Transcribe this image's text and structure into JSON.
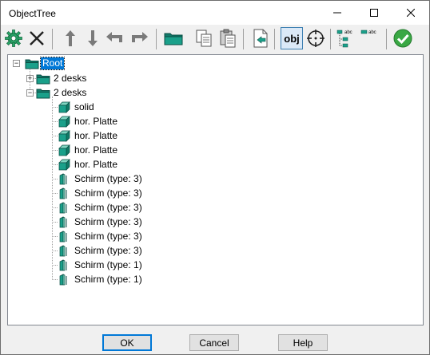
{
  "window": {
    "title": "ObjectTree"
  },
  "toolbar": {
    "buttons": [
      {
        "name": "settings-gear-icon"
      },
      {
        "name": "delete-x-icon"
      },
      {
        "name": "move-up-icon"
      },
      {
        "name": "move-down-icon"
      },
      {
        "name": "move-left-icon"
      },
      {
        "name": "move-right-icon"
      },
      {
        "name": "folder-icon"
      },
      {
        "name": "copy-icon"
      },
      {
        "name": "paste-icon"
      },
      {
        "name": "export-icon"
      },
      {
        "name": "obj-toggle",
        "label": "obj"
      },
      {
        "name": "target-icon"
      },
      {
        "name": "tree-labels-icon",
        "label": "abc"
      },
      {
        "name": "flat-labels-icon",
        "label": "abc"
      },
      {
        "name": "confirm-check-icon"
      }
    ]
  },
  "tree": {
    "root": {
      "label": "Root",
      "selected": true
    },
    "groups": [
      {
        "label": "2 desks",
        "expanded": false
      },
      {
        "label": "2 desks",
        "expanded": true
      }
    ],
    "items": [
      {
        "label": "solid",
        "icon": "box"
      },
      {
        "label": "hor. Platte",
        "icon": "box"
      },
      {
        "label": "hor. Platte",
        "icon": "box"
      },
      {
        "label": "hor. Platte",
        "icon": "box"
      },
      {
        "label": "hor. Platte",
        "icon": "box"
      },
      {
        "label": "Schirm (type: 3)",
        "icon": "panel"
      },
      {
        "label": "Schirm (type: 3)",
        "icon": "panel"
      },
      {
        "label": "Schirm (type: 3)",
        "icon": "panel"
      },
      {
        "label": "Schirm (type: 3)",
        "icon": "panel"
      },
      {
        "label": "Schirm (type: 3)",
        "icon": "panel"
      },
      {
        "label": "Schirm (type: 3)",
        "icon": "panel"
      },
      {
        "label": "Schirm (type: 1)",
        "icon": "panel"
      },
      {
        "label": "Schirm (type: 1)",
        "icon": "panel"
      }
    ]
  },
  "footer": {
    "ok": "OK",
    "cancel": "Cancel",
    "help": "Help"
  },
  "colors": {
    "selection": "#0078d7",
    "folder": "#1aa08a",
    "accent": "#3aa844",
    "toolbar_icon": "#707070"
  }
}
